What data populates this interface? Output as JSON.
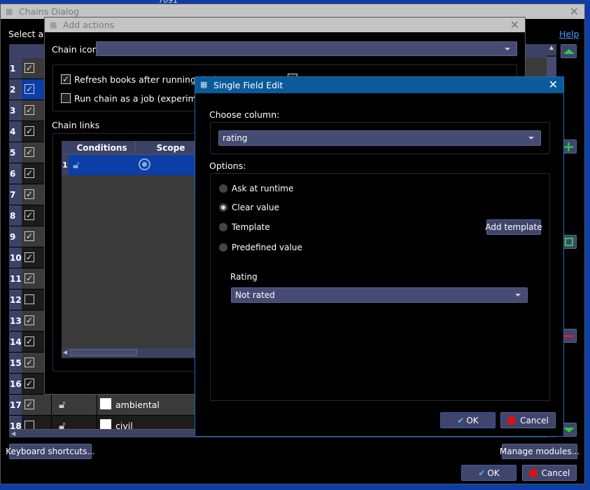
{
  "background": {
    "partial_text": "7091"
  },
  "chains_dialog": {
    "title": "Chains Dialog",
    "select_label": "Select and",
    "help_link": "Help",
    "rows": [
      {
        "n": "1",
        "checked": true
      },
      {
        "n": "2",
        "checked": true,
        "selected": true
      },
      {
        "n": "3",
        "checked": true
      },
      {
        "n": "4",
        "checked": true
      },
      {
        "n": "5",
        "checked": true
      },
      {
        "n": "6",
        "checked": true
      },
      {
        "n": "7",
        "checked": true
      },
      {
        "n": "8",
        "checked": true
      },
      {
        "n": "9",
        "checked": true
      },
      {
        "n": "10",
        "checked": true
      },
      {
        "n": "11",
        "checked": true
      },
      {
        "n": "12",
        "checked": false
      },
      {
        "n": "13",
        "checked": true
      },
      {
        "n": "14",
        "checked": true
      },
      {
        "n": "15",
        "checked": true
      },
      {
        "n": "16",
        "checked": true
      },
      {
        "n": "17",
        "checked": true,
        "name": "ambiental"
      },
      {
        "n": "18",
        "checked": false,
        "name": "civil"
      }
    ],
    "keyboard_shortcuts": "Keyboard shortcuts...",
    "manage_modules": "Manage modules...",
    "ok": "OK",
    "cancel": "Cancel"
  },
  "add_actions": {
    "title": "Add actions",
    "chain_icon_label": "Chain icon",
    "chain_icon_value": "",
    "refresh_books": "Refresh books after running chai",
    "refresh_checked": true,
    "run_as_job": "Run chain as a job (experimental",
    "run_as_job_checked": false,
    "chain_links_label": "Chain links",
    "columns": [
      "Conditions",
      "Scope"
    ],
    "row_number": "1"
  },
  "single_field_edit": {
    "title": "Single Field Edit",
    "choose_column_label": "Choose column:",
    "column_value": "rating",
    "options_label": "Options:",
    "options": [
      "Ask at runtime",
      "Clear value",
      "Template",
      "Predefined value"
    ],
    "selected_option": "Clear value",
    "add_template": "Add template",
    "rating_label": "Rating",
    "rating_value": "Not rated",
    "ok": "OK",
    "cancel": "Cancel"
  },
  "colors": {
    "accent": "#0a5a9c",
    "button": "#3f456b",
    "desktop": "#0b3ea6"
  }
}
